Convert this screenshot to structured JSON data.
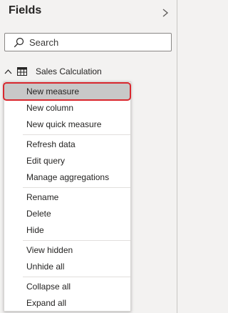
{
  "pane": {
    "title": "Fields",
    "collapse_icon": "chevron-right-icon"
  },
  "search": {
    "placeholder": "Search",
    "value": "",
    "icon": "search-icon"
  },
  "table": {
    "name": "Sales Calculation",
    "expanded": true,
    "icon": "table-icon",
    "chevron_icon": "chevron-up-icon"
  },
  "context_menu": {
    "groups": [
      {
        "items": [
          "New measure",
          "New column",
          "New quick measure"
        ]
      },
      {
        "items": [
          "Refresh data",
          "Edit query",
          "Manage aggregations"
        ]
      },
      {
        "items": [
          "Rename",
          "Delete",
          "Hide"
        ]
      },
      {
        "items": [
          "View hidden",
          "Unhide all"
        ]
      },
      {
        "items": [
          "Collapse all",
          "Expand all"
        ]
      }
    ],
    "selected_item": "New measure"
  },
  "colors": {
    "pane_background": "#f3f2f1",
    "menu_background": "#ffffff",
    "selected_background": "#c8c8c8",
    "highlight_ring": "#d9272e",
    "text": "#252423"
  }
}
